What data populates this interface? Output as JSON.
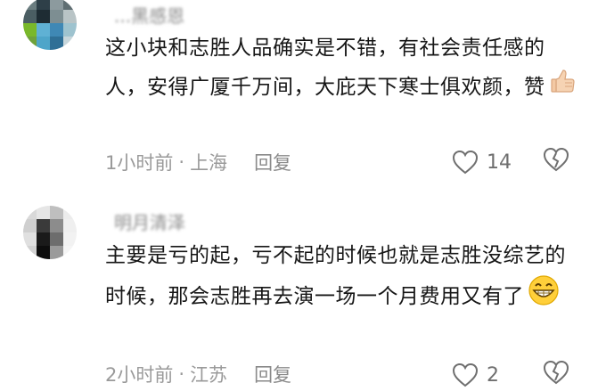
{
  "comments": [
    {
      "username": "...黑感恩",
      "text": "这小块和志胜人品确实是不错，有社会责任感的人，安得广厦千万间，大庇天下寒士俱欢颜，赞",
      "emoji": "thumbs-up-icon",
      "time": "1小时前",
      "location": "上海",
      "reply_label": "回复",
      "like_count": "14",
      "separator": "·"
    },
    {
      "username": "明月清泽",
      "text": "主要是亏的起，亏不起的时候也就是志胜没综艺的时候，那会志胜再去演一场一个月费用又有了",
      "emoji": "grinning-face-icon",
      "time": "2小时前",
      "location": "江苏",
      "reply_label": "回复",
      "like_count": "2",
      "separator": "·"
    }
  ],
  "colors": {
    "text": "#161616",
    "meta": "#9a9a9a",
    "icon": "#6f6f6f"
  }
}
